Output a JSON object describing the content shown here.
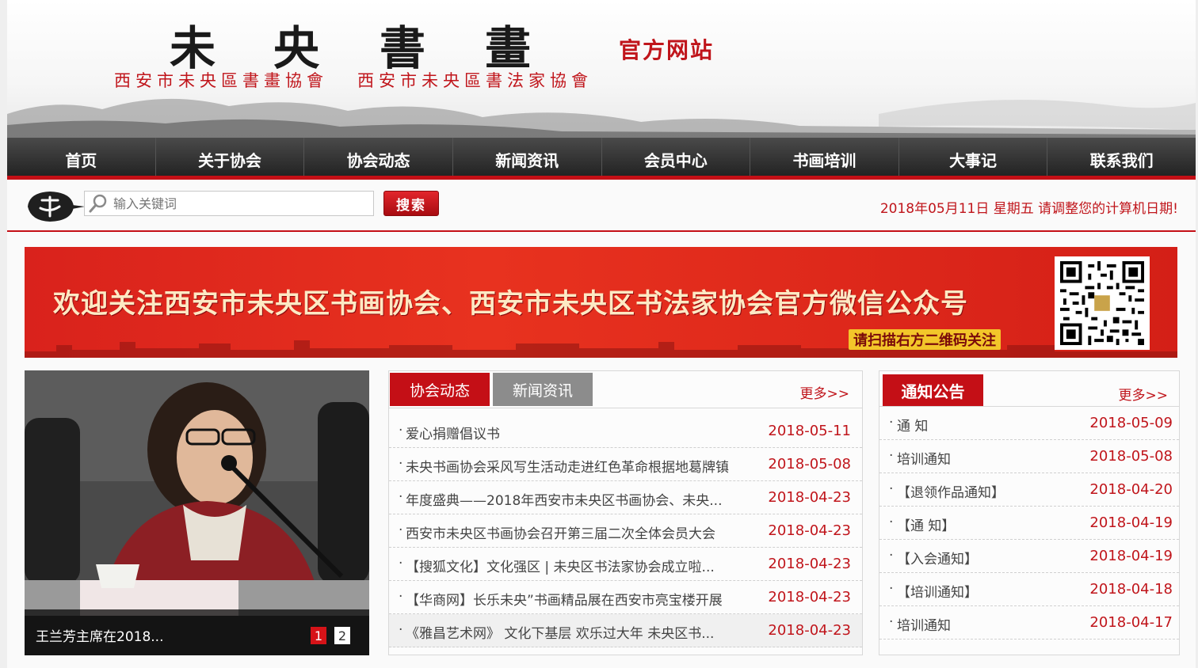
{
  "header": {
    "title_chars": [
      "未",
      "央",
      "書",
      "畫"
    ],
    "official": "官方网站",
    "subtitle_left": "西安市未央區書畫協會",
    "subtitle_right": "西安市未央區書法家協會"
  },
  "nav": [
    "首页",
    "关于协会",
    "协会动态",
    "新闻资讯",
    "会员中心",
    "书画培训",
    "大事记",
    "联系我们"
  ],
  "search": {
    "placeholder": "输入关键词",
    "button": "搜索"
  },
  "date_text": "2018年05月11日 星期五  请调整您的计算机日期!",
  "banner": {
    "text": "欢迎关注西安市未央区书画协会、西安市未央区书法家协会官方微信公众号",
    "sub": "请扫描右方二维码关注"
  },
  "slider": {
    "caption": "王兰芳主席在2018...",
    "pages": [
      "1",
      "2"
    ]
  },
  "news": {
    "tabs": [
      "协会动态",
      "新闻资讯"
    ],
    "more": "更多>>",
    "items": [
      {
        "title": "爱心捐赠倡议书",
        "date": "2018-05-11"
      },
      {
        "title": "未央书画协会采风写生活动走进红色革命根据地葛牌镇",
        "date": "2018-05-08"
      },
      {
        "title": "年度盛典——2018年西安市未央区书画协会、未央...",
        "date": "2018-04-23"
      },
      {
        "title": "西安市未央区书画协会召开第三届二次全体会员大会",
        "date": "2018-04-23"
      },
      {
        "title": "【搜狐文化】文化强区 | 未央区书法家协会成立啦...",
        "date": "2018-04-23"
      },
      {
        "title": "【华商网】长乐未央”书画精品展在西安市亮宝楼开展",
        "date": "2018-04-23"
      },
      {
        "title": "《雅昌艺术网》 文化下基层 欢乐过大年 未央区书...",
        "date": "2018-04-23"
      }
    ]
  },
  "notice": {
    "title": "通知公告",
    "more": "更多>>",
    "items": [
      {
        "title": "通 知",
        "date": "2018-05-09"
      },
      {
        "title": "培训通知",
        "date": "2018-05-08"
      },
      {
        "title": "【退领作品通知】",
        "date": "2018-04-20"
      },
      {
        "title": "【通 知】",
        "date": "2018-04-19"
      },
      {
        "title": "【入会通知】",
        "date": "2018-04-19"
      },
      {
        "title": "【培训通知】",
        "date": "2018-04-18"
      },
      {
        "title": "培训通知",
        "date": "2018-04-17"
      }
    ]
  },
  "colors": {
    "brand_red": "#c40f16",
    "date_red": "#c0151b",
    "nav_dark": "#2b2b2b",
    "tab_gray": "#8c8c8c"
  }
}
